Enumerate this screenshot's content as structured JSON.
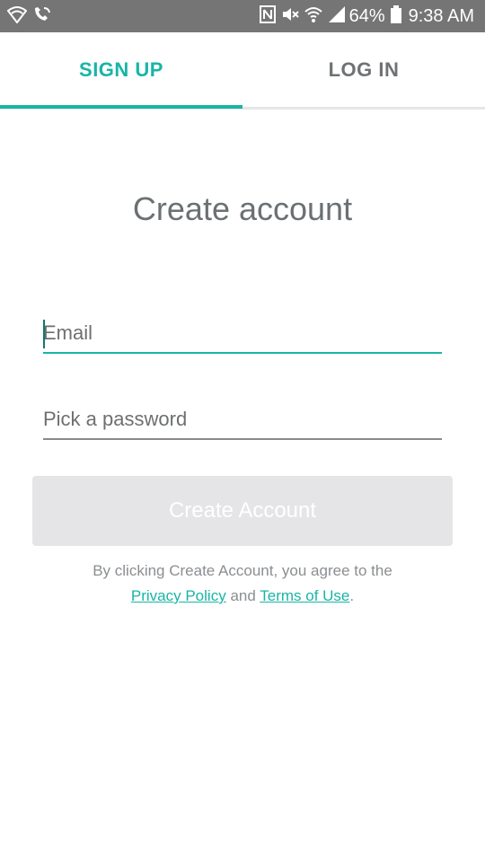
{
  "status_bar": {
    "battery_percent": "64%",
    "time": "9:38 AM",
    "icons_left": [
      "wifi-shield-icon",
      "wifi-call-icon"
    ],
    "icons_right": [
      "nfc-icon",
      "mute-icon",
      "wifi-icon",
      "signal-icon",
      "battery-icon"
    ]
  },
  "tabs": [
    {
      "label": "SIGN UP",
      "active": true
    },
    {
      "label": "LOG IN",
      "active": false
    }
  ],
  "page_title": "Create account",
  "form": {
    "email_placeholder": "Email",
    "password_placeholder": "Pick a password",
    "submit_label": "Create Account"
  },
  "legal": {
    "prefix": "By clicking Create Account, you agree to the",
    "privacy_link": "Privacy Policy",
    "conjunction": "and",
    "terms_link": "Terms of Use",
    "suffix": "."
  },
  "colors": {
    "accent": "#19b5a6",
    "status_bar": "#757575",
    "button_disabled": "#e5e5e7"
  }
}
